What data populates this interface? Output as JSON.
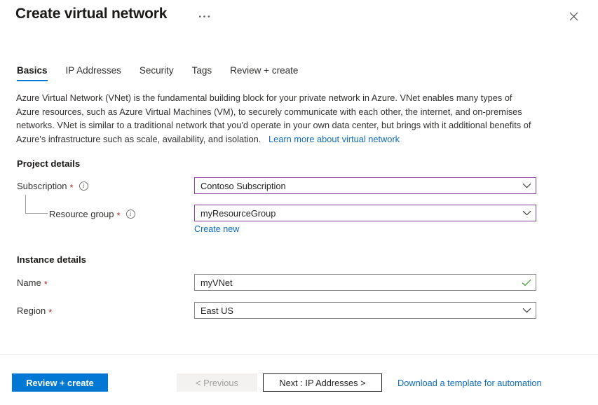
{
  "header": {
    "title": "Create virtual network",
    "ellipsis_label": "•••",
    "close_label": "Close"
  },
  "tabs": [
    {
      "label": "Basics",
      "active": true
    },
    {
      "label": "IP Addresses",
      "active": false
    },
    {
      "label": "Security",
      "active": false
    },
    {
      "label": "Tags",
      "active": false
    },
    {
      "label": "Review + create",
      "active": false
    }
  ],
  "description": {
    "body": "Azure Virtual Network (VNet) is the fundamental building block for your private network in Azure. VNet enables many types of Azure resources, such as Azure Virtual Machines (VM), to securely communicate with each other, the internet, and on-premises networks. VNet is similar to a traditional network that you'd operate in your own data center, but brings with it additional benefits of Azure's infrastructure such as scale, availability, and isolation.",
    "learn_more_label": "Learn more about virtual network"
  },
  "project_details": {
    "heading": "Project details",
    "subscription": {
      "label": "Subscription",
      "required": "*",
      "value": "Contoso Subscription"
    },
    "resource_group": {
      "label": "Resource group",
      "required": "*",
      "value": "myResourceGroup",
      "create_new_label": "Create new"
    }
  },
  "instance_details": {
    "heading": "Instance details",
    "name": {
      "label": "Name",
      "required": "*",
      "value": "myVNet"
    },
    "region": {
      "label": "Region",
      "required": "*",
      "value": "East US"
    }
  },
  "footer": {
    "review_create_label": "Review + create",
    "previous_label": "< Previous",
    "next_label": "Next : IP Addresses >",
    "download_template_label": "Download a template for automation"
  },
  "colors": {
    "accent": "#0078d4",
    "link": "#0f6cbd",
    "required_star": "#a4262c",
    "focus_border": "#8a3fa0",
    "validation_check": "#4ca33c",
    "neutral_border": "#8a8886"
  }
}
